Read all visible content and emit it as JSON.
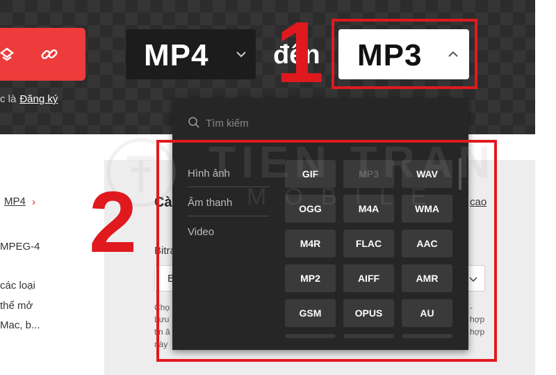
{
  "header": {
    "from_format": "MP4",
    "to_word": "đến",
    "to_format": "MP3",
    "sub_text": "c là",
    "register_link": "Đăng ký"
  },
  "annotations": {
    "marker_1": "1",
    "marker_2": "2"
  },
  "dropdown": {
    "search_placeholder": "Tìm kiếm",
    "categories": [
      {
        "label": "Hình ảnh"
      },
      {
        "label": "Âm thanh"
      },
      {
        "label": "Video"
      }
    ],
    "formats": [
      "GIF",
      "MP3",
      "WAV",
      "OGG",
      "M4A",
      "WMA",
      "M4R",
      "FLAC",
      "AAC",
      "MP2",
      "AIFF",
      "AMR",
      "GSM",
      "OPUS",
      "AU"
    ],
    "current_format": "MP3"
  },
  "page": {
    "left_link": "MP4",
    "left_lines": [
      "MPEG-4",
      "các loại",
      "thể mở",
      "Mac, b..."
    ],
    "panel_title": "Cài",
    "panel_advanced": "cao",
    "panel_bitrate": "Bitra",
    "panel_select_value": "B",
    "panel_help_left": [
      "Chọ",
      "Lưu",
      "tin â",
      "này"
    ],
    "panel_help_right": [
      "-",
      "hợp",
      "hợp"
    ]
  },
  "watermark": {
    "title": "TIEN TRAN",
    "subtitle": "MOBILE"
  },
  "colors": {
    "accent_red": "#ee3b3b",
    "annotation_red": "#e0191f",
    "dropdown_bg": "#262626",
    "button_bg": "#3a3a3a"
  }
}
